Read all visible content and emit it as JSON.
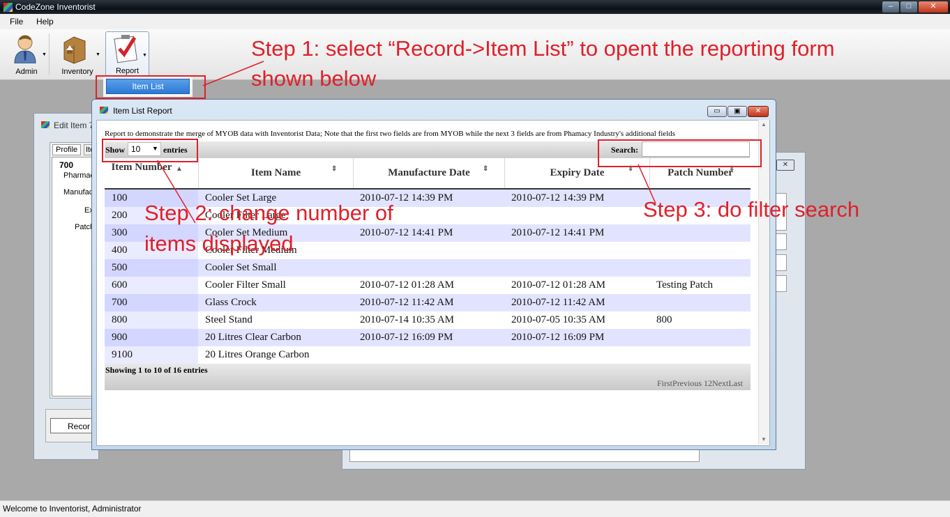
{
  "window": {
    "title": "CodeZone Inventorist",
    "min": "‒",
    "max": "□",
    "close": "✕"
  },
  "menu": [
    "File",
    "Help"
  ],
  "toolbar": {
    "admin": "Admin",
    "inventory": "Inventory",
    "report": "Report"
  },
  "dropdown": {
    "item_list": "Item List"
  },
  "edit_window": {
    "title": "Edit Item 7",
    "tabs": [
      "Profile",
      "Ite"
    ],
    "item_no": "700",
    "labels": [
      "Pharmac",
      "Manufac",
      "Ex",
      "Patch"
    ],
    "button": "Recor"
  },
  "report": {
    "title": "Item List Report",
    "description": "Report to demonstrate the merge of MYOB data with Inventorist Data; Note that the first two fields are from MYOB while the next 3 fields are from Phamacy Industry's additional fields",
    "show_label": "Show",
    "entries_value": "10",
    "entries_label": "entries",
    "search_label": "Search:",
    "search_value": "",
    "columns": [
      "Item Number",
      "Item Name",
      "Manufacture Date",
      "Expiry Date",
      "Patch Number"
    ],
    "rows": [
      [
        "100",
        "Cooler Set Large",
        "2010-07-12 14:39 PM",
        "2010-07-12 14:39 PM",
        ""
      ],
      [
        "200",
        "Cooler Filter Large",
        "",
        "",
        ""
      ],
      [
        "300",
        "Cooler Set Medium",
        "2010-07-12 14:41 PM",
        "2010-07-12 14:41 PM",
        ""
      ],
      [
        "400",
        "Cooler Filter Medium",
        "",
        "",
        ""
      ],
      [
        "500",
        "Cooler Set Small",
        "",
        "",
        ""
      ],
      [
        "600",
        "Cooler Filter Small",
        "2010-07-12 01:28 AM",
        "2010-07-12 01:28 AM",
        "Testing Patch"
      ],
      [
        "700",
        "Glass Crock",
        "2010-07-12 11:42 AM",
        "2010-07-12 11:42 AM",
        ""
      ],
      [
        "800",
        "Steel Stand",
        "2010-07-14 10:35 AM",
        "2010-07-05 10:35 AM",
        "800"
      ],
      [
        "900",
        "20 Litres Clear Carbon",
        "2010-07-12 16:09 PM",
        "2010-07-12 16:09 PM",
        ""
      ],
      [
        "9100",
        "20 Litres Orange Carbon",
        "",
        "",
        ""
      ]
    ],
    "showing": "Showing 1 to 10 of 16 entries",
    "pager": [
      "First",
      "Previous",
      "1",
      "2",
      "Next",
      "Last"
    ]
  },
  "annotations": {
    "step1_line1": "Step 1: select “Record->Item List” to opent the reporting form",
    "step1_line2": "shown below",
    "step2_line1": "Step 2: change number of",
    "step2_line2": "items displayed",
    "step3": "Step 3: do filter search"
  },
  "status": "Welcome to Inventorist, Administrator",
  "colors": {
    "row_odd": "#e2e4ff",
    "row_even": "#ffffff",
    "sorted_odd": "#d3d6ff",
    "sorted_even": "#eaebff",
    "annotation": "#e0202a"
  }
}
